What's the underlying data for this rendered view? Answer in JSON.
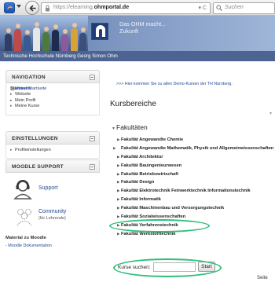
{
  "browser": {
    "url_prefix": "https://elearning.",
    "url_domain": "ohmportal.de",
    "url_controls": "▾ C",
    "search_placeholder": "Suchen"
  },
  "header": {
    "tagline_line1": "Das OHM macht...",
    "tagline_line2": "Zukunft",
    "institution": "Technische Hochschule Nürnberg Georg Simon Ohm"
  },
  "navigation": {
    "title": "NAVIGATION",
    "items": [
      {
        "marker": "",
        "label": "Startseite"
      },
      {
        "marker": "•",
        "label": "Meine Startseite"
      },
      {
        "marker": "▸",
        "label": "Website"
      },
      {
        "marker": "▸",
        "label": "Mein Profil"
      },
      {
        "marker": "▸",
        "label": "Meine Kurse"
      }
    ]
  },
  "settings": {
    "title": "EINSTELLUNGEN",
    "items": [
      {
        "marker": "▸",
        "label": "Profileinstellungen"
      }
    ]
  },
  "moodle_support": {
    "title": "MOODLE SUPPORT",
    "support_label": "Support",
    "community_label": "Community",
    "community_sub": "(für Lehrende)",
    "material_head": "Material zu Moodle",
    "material_link": "- Moodle Dokumentation"
  },
  "main": {
    "notice": ">>> Hier kommen Sie zu allen Demo-Kursen der TH Nürnberg.",
    "page_title": "Kursbereiche",
    "collapse_marker": "▾",
    "category": "Fakultäten",
    "faculties": [
      "Fakultät Angewandte Chemie",
      "Fakultät Angewandte Mathematik, Physik und Allgemeinwissenschaften",
      "Fakultät Architektur",
      "Fakultät Bauingenieurwesen",
      "Fakultät Betriebswirtschaft",
      "Fakultät Design",
      "Fakultät Elektrotechnik Feinwerktechnik Informationstechnik",
      "Fakultät Informatik",
      "Fakultät Maschinenbau und Versorgungstechnik",
      "Fakultät Sozialwissenschaften",
      "Fakultät Verfahrenstechnik",
      "Fakultät Werkstofftechnik"
    ],
    "course_search_label": "Kurse suchen:",
    "course_search_value": "",
    "start_button": "Start",
    "footer_text": "Seite"
  },
  "colors": {
    "highlight": "#2fbf7a",
    "header_bar": "#4d6493",
    "link": "#224b8f"
  }
}
